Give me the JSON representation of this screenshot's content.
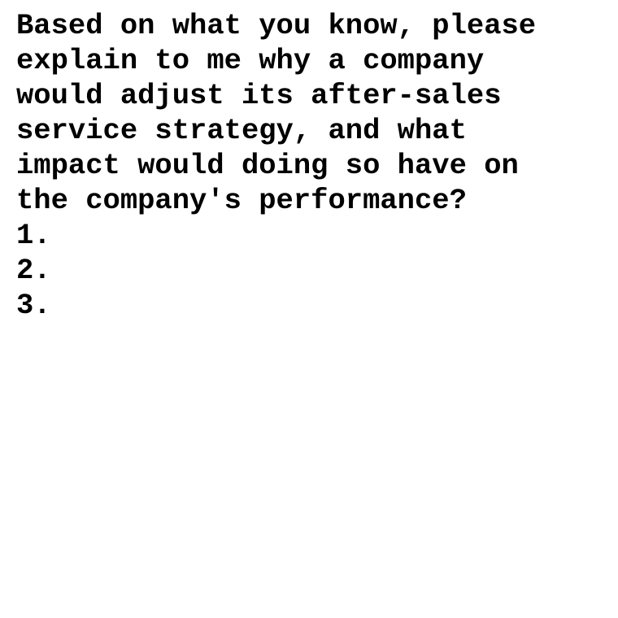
{
  "document": {
    "lines": [
      "Based on what you know, please",
      "explain to me why a company",
      "would adjust its after-sales",
      "service strategy, and what",
      "impact would doing so have on",
      "the company's performance?",
      "1.",
      "2.",
      "3."
    ]
  }
}
